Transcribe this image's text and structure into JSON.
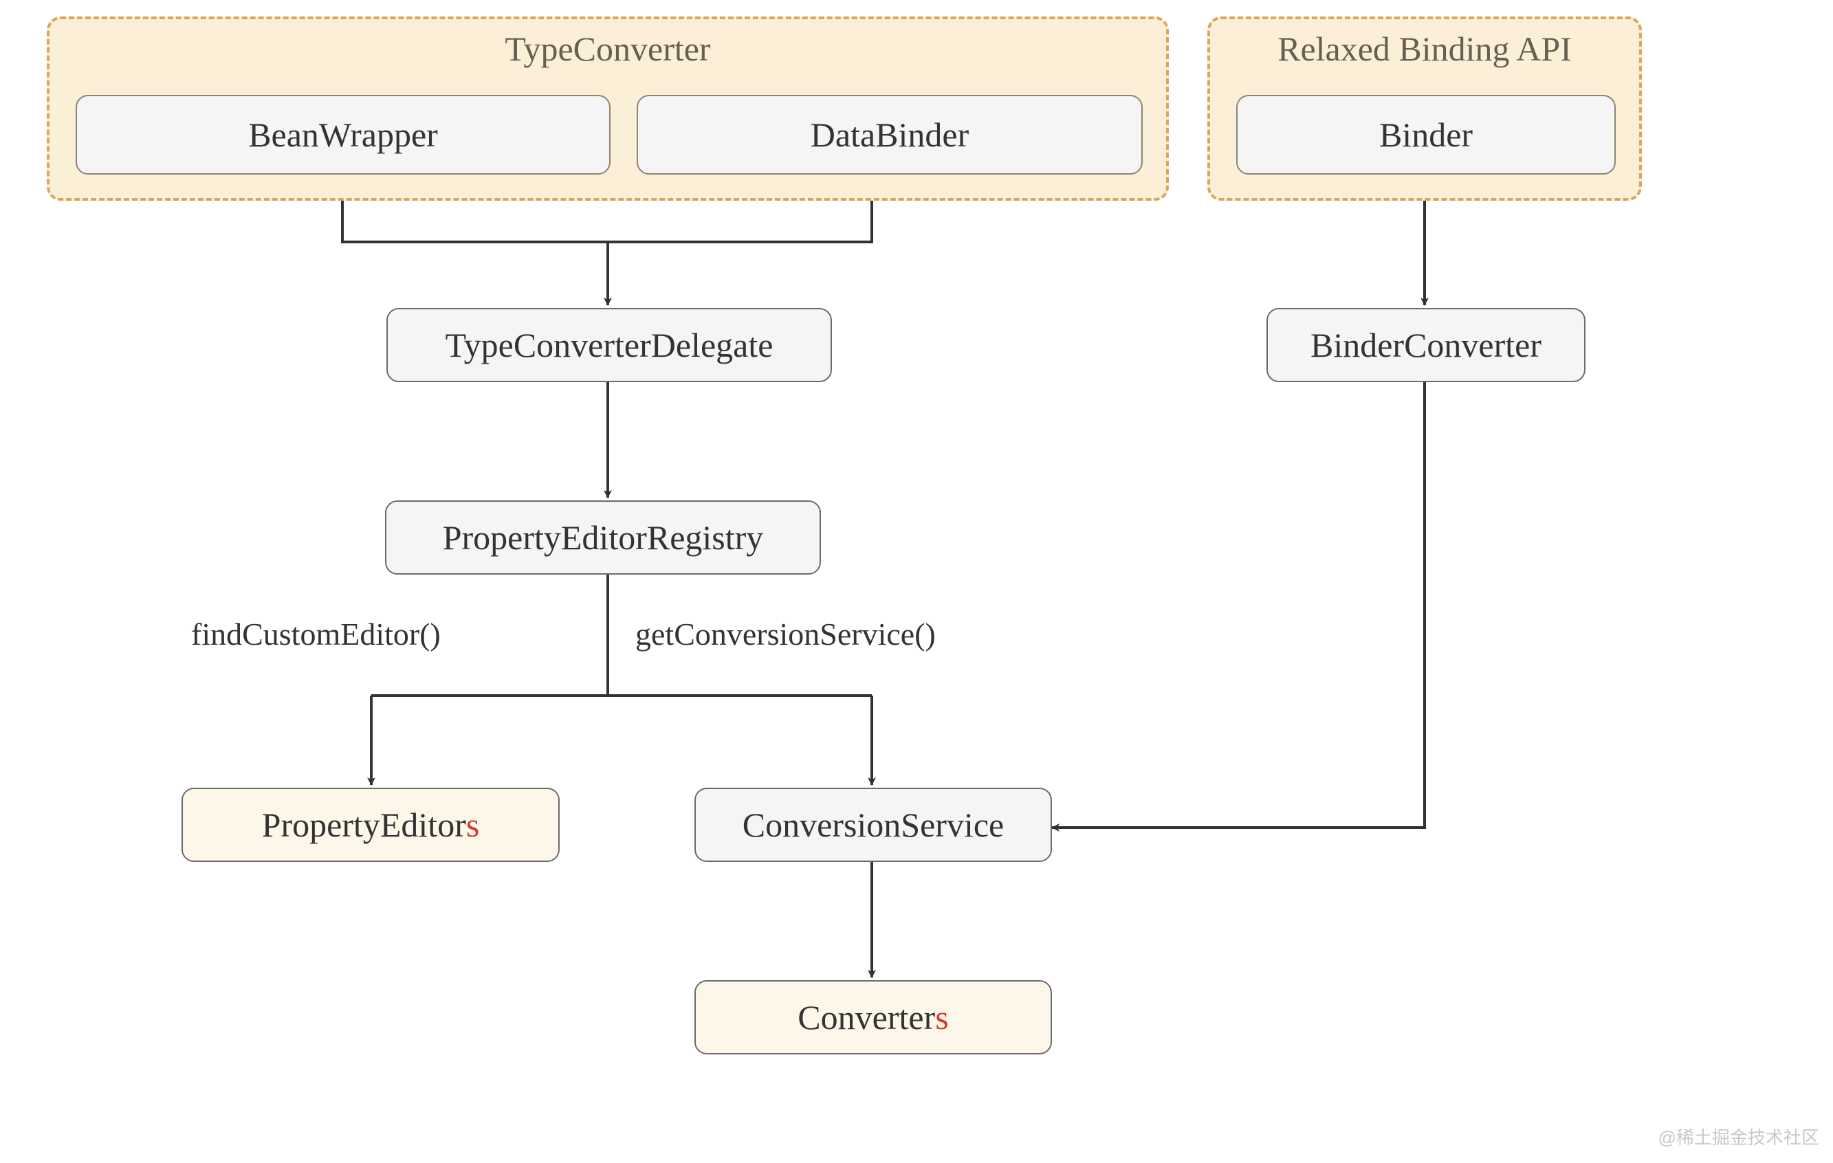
{
  "clusters": {
    "typeconverter": {
      "title": "TypeConverter"
    },
    "relaxed": {
      "title": "Relaxed Binding API"
    }
  },
  "nodes": {
    "beanwrapper": "BeanWrapper",
    "databinder": "DataBinder",
    "binder": "Binder",
    "typeconverterdelegate": "TypeConverterDelegate",
    "binderconverter": "BinderConverter",
    "propertyeditorregistry": "PropertyEditorRegistry",
    "propertyeditors_stem": "PropertyEditor",
    "propertyeditors_s": "s",
    "conversionservice": "ConversionService",
    "converters_stem": "Converter",
    "converters_s": "s"
  },
  "edgeLabels": {
    "findCustomEditor": "findCustomEditor()",
    "getConversionService": "getConversionService()"
  },
  "watermark": "@稀土掘金技术社区"
}
